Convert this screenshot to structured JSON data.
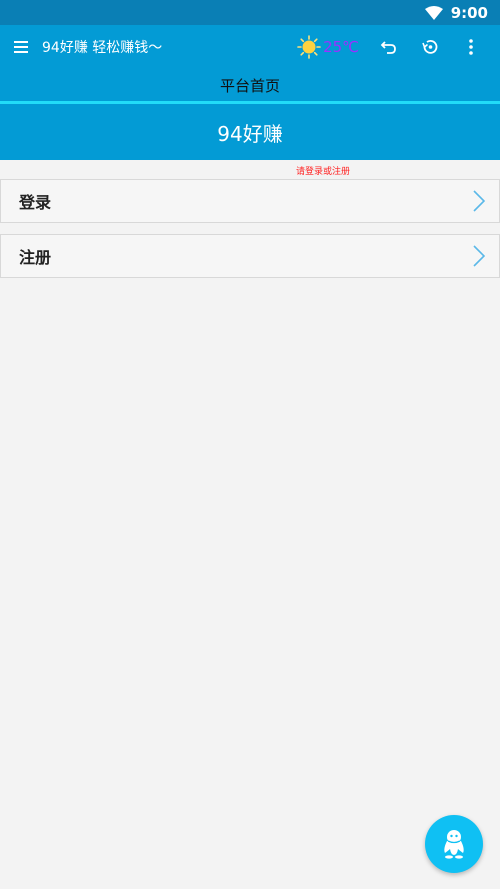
{
  "status_bar": {
    "time": "9:00"
  },
  "app_bar": {
    "title": "94好赚 轻松赚钱～",
    "temperature": "25℃",
    "temperature_color": "#9b30ff"
  },
  "sub_header": {
    "title": "平台首页"
  },
  "banner": {
    "title": "94好赚"
  },
  "hint": {
    "text": "请登录或注册"
  },
  "list": [
    {
      "label": "登录"
    },
    {
      "label": "注册"
    }
  ],
  "colors": {
    "primary": "#039bd5",
    "accent_line": "#22dcf8",
    "fab": "#0fc0f3",
    "hint": "#ff2222"
  },
  "icons": {
    "menu": "menu-icon",
    "weather": "sun-icon",
    "undo": "undo-icon",
    "history": "history-icon",
    "more": "more-vert-icon",
    "chevron": "chevron-right-icon",
    "fab": "qq-penguin-icon"
  }
}
